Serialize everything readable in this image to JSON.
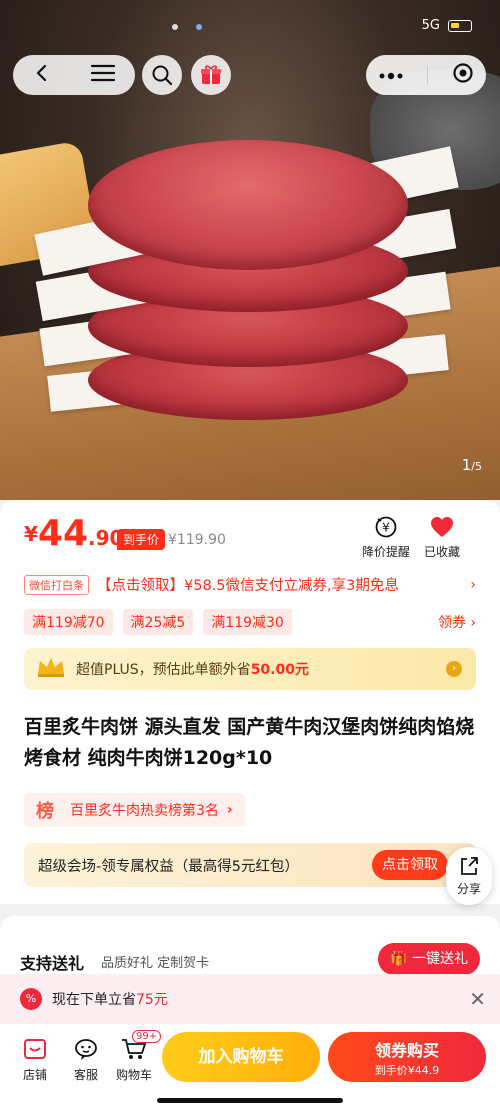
{
  "statusbar": {
    "network": "5G",
    "battery_icon": "battery-icon"
  },
  "hero": {
    "page_current": "1",
    "page_total": "/5"
  },
  "nav": {
    "back_icon": "back-icon",
    "menu_icon": "menu-icon",
    "search_icon": "search-icon",
    "gift_icon": "gift-icon",
    "more_icon": "more-icon",
    "close_icon": "target-icon"
  },
  "price": {
    "currency": "¥",
    "integer": "44",
    "decimal": ".90",
    "tag": "到手价",
    "original": "¥119.90",
    "actions": [
      {
        "label": "降价提醒",
        "icon": "price-alert-icon"
      },
      {
        "label": "已收藏",
        "icon": "heart-icon"
      }
    ]
  },
  "wechat_promo": {
    "tag": "微信打白条",
    "text": "【点击领取】¥58.5微信支付立减券,享3期免息",
    "chevron": "›"
  },
  "coupons": {
    "items": [
      "满119减70",
      "满25减5",
      "满119减30"
    ],
    "claim": "领券 ›"
  },
  "plus": {
    "text": "超值PLUS，预估此单额外省",
    "amount": "50.00元",
    "icon": "crown-icon"
  },
  "product": {
    "title": "百里炙牛肉饼 源头直发 国产黄牛肉汉堡肉饼纯肉馅烧烤食材 纯肉牛肉饼120g*10"
  },
  "rank": {
    "badge": "榜",
    "text": "百里炙牛肉热卖榜第3名",
    "arrow": "›"
  },
  "venue": {
    "text": "超级会场-领专属权益（最高得5元红包）",
    "button": "点击领取"
  },
  "share": {
    "label": "分享",
    "icon": "share-icon"
  },
  "gift": {
    "title": "支持送礼",
    "subtitle": "品质好礼 定制贺卡",
    "button": "一键送礼"
  },
  "save_banner": {
    "text": "现在下单立省",
    "amount": "75元",
    "badge": "%"
  },
  "bottom": {
    "items": [
      {
        "label": "店铺",
        "icon": "store-icon"
      },
      {
        "label": "客服",
        "icon": "customer-service-icon"
      },
      {
        "label": "购物车",
        "icon": "cart-icon",
        "badge": "99+"
      }
    ],
    "add_cart": "加入购物车",
    "buy": "领券购买",
    "buy_sub": "到手价¥44.9"
  },
  "colors": {
    "accent": "#ff2d1a",
    "gift_red": "#f0283c",
    "cart_yellow": "#ffb00a"
  }
}
